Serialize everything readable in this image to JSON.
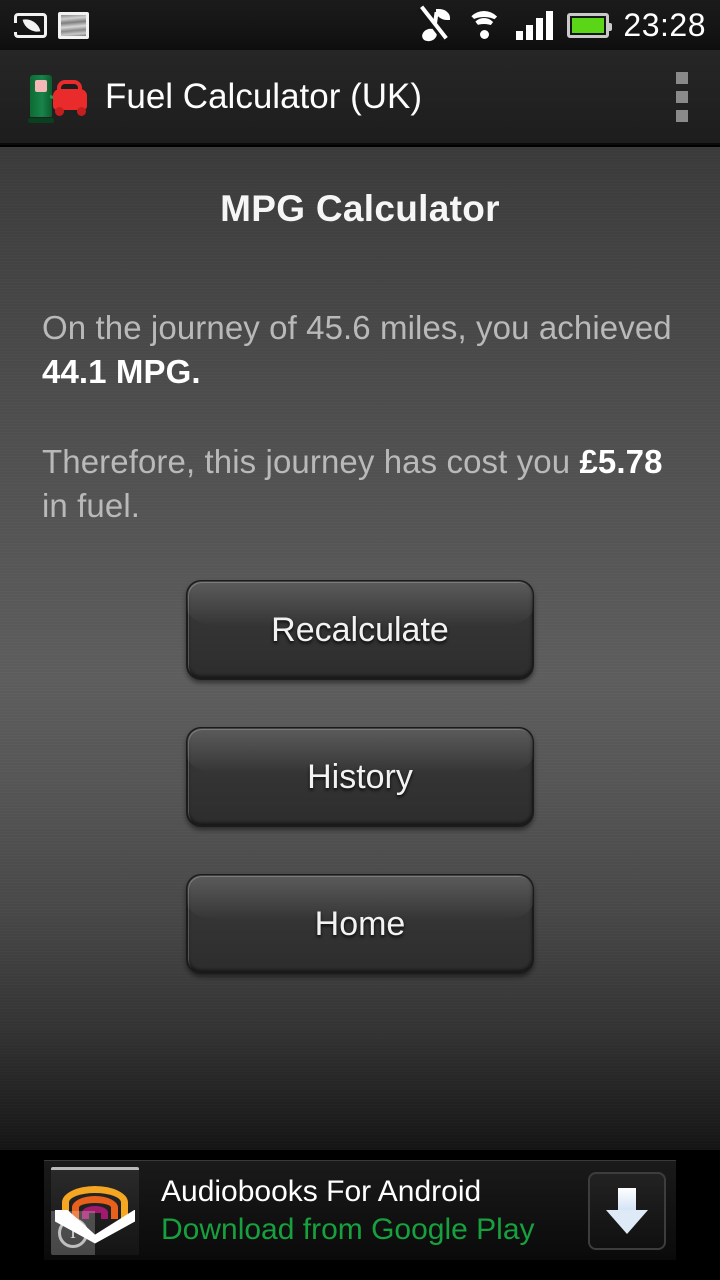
{
  "statusbar": {
    "icons": [
      "eco-mode-icon",
      "screenshot-icon",
      "music-muted-icon",
      "wifi-icon",
      "signal-icon",
      "battery-icon"
    ],
    "clock": "23:28",
    "battery_color": "#5bd517"
  },
  "actionbar": {
    "app_icon": "fuel-pump-car-icon",
    "title": "Fuel Calculator (UK)",
    "overflow_label": "overflow-menu"
  },
  "main": {
    "page_title": "MPG Calculator",
    "result": {
      "line1_prefix": "On the journey of 45.6 miles, you achieved ",
      "line1_value": "44.1 MPG.",
      "line2_prefix": "Therefore, this journey has cost you ",
      "line2_value": "£5.78",
      "line2_suffix": " in fuel.",
      "distance_miles": "45.6",
      "mpg": "44.1",
      "cost": "£5.78"
    },
    "buttons": [
      {
        "label": "Recalculate",
        "name": "recalculate-button"
      },
      {
        "label": "History",
        "name": "history-button"
      },
      {
        "label": "Home",
        "name": "home-button"
      }
    ]
  },
  "ad": {
    "icon": "audiobooks-app-icon",
    "title": "Audiobooks For Android",
    "subtitle": "Download from Google Play",
    "subtitle_color": "#17a03e",
    "info_badge": "i",
    "download_label": "download-arrow"
  }
}
